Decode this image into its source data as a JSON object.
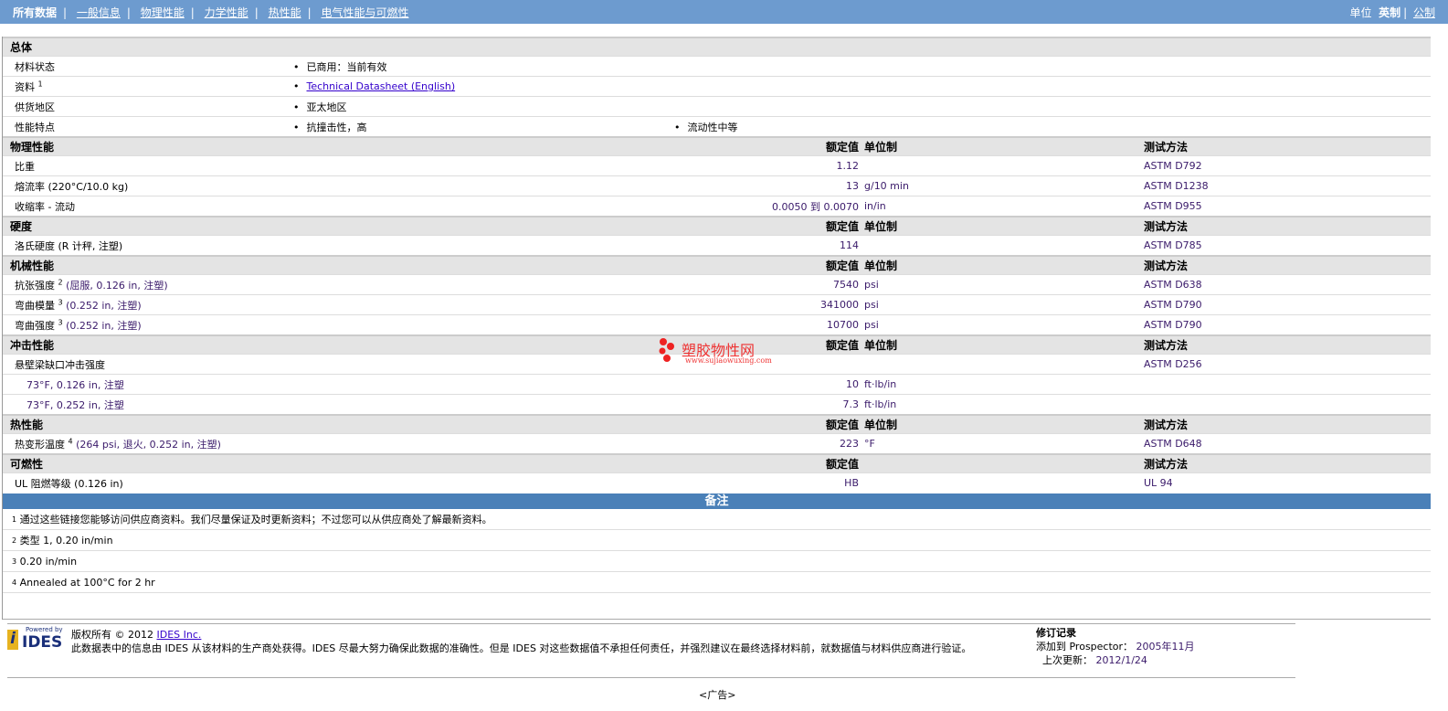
{
  "nav": {
    "tabs": [
      "所有数据",
      "一般信息",
      "物理性能",
      "力学性能",
      "热性能",
      "电气性能与可燃性"
    ],
    "units_label": "单位",
    "unit_active": "英制",
    "unit_other": "公制"
  },
  "general": {
    "title": "总体",
    "rows": [
      {
        "label": "材料状态",
        "values": [
          "已商用：当前有效"
        ]
      },
      {
        "label": "资料",
        "sup": "1",
        "link": "Technical Datasheet (English)"
      },
      {
        "label": "供货地区",
        "values": [
          "亚太地区"
        ]
      },
      {
        "label": "性能特点",
        "values": [
          "抗撞击性，高",
          "流动性中等"
        ]
      }
    ]
  },
  "headers": {
    "nominal": "额定值",
    "unit": "单位制",
    "method": "测试方法"
  },
  "physical": {
    "title": "物理性能",
    "rows": [
      {
        "label": "比重",
        "value": "1.12",
        "unit": "",
        "method": "ASTM D792"
      },
      {
        "label": "熔流率 (220°C/10.0 kg)",
        "value": "13",
        "unit": "g/10 min",
        "method": "ASTM D1238"
      },
      {
        "label": "收缩率 - 流动",
        "value": "0.0050 到 0.0070",
        "unit": "in/in",
        "method": "ASTM D955"
      }
    ]
  },
  "hardness": {
    "title": "硬度",
    "rows": [
      {
        "label": "洛氏硬度 (R 计秤, 注塑)",
        "value": "114",
        "unit": "",
        "method": "ASTM D785"
      }
    ]
  },
  "mechanical": {
    "title": "机械性能",
    "rows": [
      {
        "label": "抗张强度",
        "sup": "2",
        "cond": "(屈服, 0.126 in, 注塑)",
        "value": "7540",
        "unit": "psi",
        "method": "ASTM D638"
      },
      {
        "label": "弯曲模量",
        "sup": "3",
        "cond": "(0.252 in, 注塑)",
        "value": "341000",
        "unit": "psi",
        "method": "ASTM D790"
      },
      {
        "label": "弯曲强度",
        "sup": "3",
        "cond": "(0.252 in, 注塑)",
        "value": "10700",
        "unit": "psi",
        "method": "ASTM D790"
      }
    ]
  },
  "impact": {
    "title": "冲击性能",
    "main": "悬壁梁缺口冲击强度",
    "method": "ASTM D256",
    "rows": [
      {
        "label": "73°F, 0.126 in, 注塑",
        "value": "10",
        "unit": "ft·lb/in"
      },
      {
        "label": "73°F, 0.252 in, 注塑",
        "value": "7.3",
        "unit": "ft·lb/in"
      }
    ]
  },
  "thermal": {
    "title": "热性能",
    "rows": [
      {
        "label": "热变形温度",
        "sup": "4",
        "cond": "(264 psi, 退火, 0.252 in, 注塑)",
        "value": "223",
        "unit": "°F",
        "method": "ASTM D648"
      }
    ]
  },
  "flammability": {
    "title": "可燃性",
    "rows": [
      {
        "label": "UL 阻燃等级 (0.126 in)",
        "value": "HB",
        "method": "UL 94"
      }
    ]
  },
  "notes": {
    "title": "备注",
    "items": [
      {
        "n": "1",
        "text": "通过这些链接您能够访问供应商资料。我们尽量保证及时更新资料；不过您可以从供应商处了解最新资料。"
      },
      {
        "n": "2",
        "text": "类型  1, 0.20 in/min"
      },
      {
        "n": "3",
        "text": "0.20 in/min"
      },
      {
        "n": "4",
        "text": "Annealed at 100°C for 2 hr"
      }
    ]
  },
  "footer": {
    "logo": "Powered by IDES",
    "copyright": "版权所有 © 2012",
    "company": "IDES Inc.",
    "disclaimer": "此数据表中的信息由 IDES 从该材料的生产商处获得。IDES 尽最大努力确保此数据的准确性。但是 IDES 对这些数据值不承担任何责任，并强烈建议在最终选择材料前，就数据值与材料供应商进行验证。",
    "rev_title": "修订记录",
    "added_label": "添加到 Prospector：",
    "added": "2005年11月",
    "updated_label": "上次更新：",
    "updated": "2012/1/24",
    "ad": "<广告>"
  },
  "watermark": {
    "text": "塑胶物性网",
    "url": "www.sujiaowuxing.com"
  }
}
